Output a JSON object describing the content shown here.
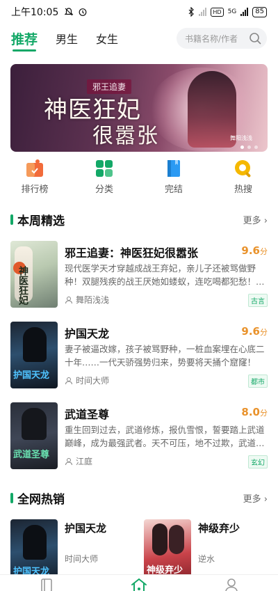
{
  "status_bar": {
    "time": "上午10:05",
    "network": "5G",
    "battery": "85"
  },
  "top_tabs": [
    {
      "label": "推荐",
      "active": true
    },
    {
      "label": "男生",
      "active": false
    },
    {
      "label": "女生",
      "active": false
    }
  ],
  "search": {
    "placeholder": "书籍名称/作者"
  },
  "banner": {
    "subtitle": "邪王追妻",
    "title_line1": "神医狂妃",
    "title_line2": "很嚣张",
    "author_mark": "舞阳浅浅"
  },
  "quick_entries": [
    {
      "label": "排行榜",
      "icon": "ranking-icon",
      "color": "#f26b3a"
    },
    {
      "label": "分类",
      "icon": "category-icon",
      "color": "#13a867"
    },
    {
      "label": "完结",
      "icon": "finished-book-icon",
      "color": "#2b9af3"
    },
    {
      "label": "热搜",
      "icon": "hot-search-icon",
      "color": "#f5b800"
    }
  ],
  "weekly": {
    "title": "本周精选",
    "more": "更多",
    "books": [
      {
        "name": "邪王追妻：神医狂妃很嚣张",
        "score": "9.6",
        "unit": "分",
        "desc": "现代医学天才穿越成战王弃妃，亲儿子还被骂做野种！双腿残疾的战王厌她如蝼蚁，连吃喝都犯愁！…",
        "author": "舞陌浅浅",
        "tag": "古言",
        "cover_text": "神医狂妃"
      },
      {
        "name": "护国天龙",
        "score": "9.6",
        "unit": "分",
        "desc": "妻子被逼改嫁，孩子被骂野种，一桩血案埋在心底二十年……一代天骄强势归来，势要将天捅个窟窿！",
        "author": "时间大师",
        "tag": "都市",
        "cover_text": "护国天龙"
      },
      {
        "name": "武道圣尊",
        "score": "8.0",
        "unit": "分",
        "desc": "重生回到过去，武道修炼，报仇雪恨，誓要踏上武道巅峰，成为最强武者。天不可压，地不过欺，武道…",
        "author": "江庭",
        "tag": "玄幻",
        "cover_text": "武道圣尊"
      }
    ]
  },
  "hot": {
    "title": "全网热销",
    "more": "更多",
    "books": [
      {
        "name": "护国天龙",
        "author": "时间大师",
        "cover_text": "护国天龙"
      },
      {
        "name": "神级弃少",
        "author": "逆水",
        "cover_text": "神级弃少"
      }
    ]
  },
  "bottom_nav": [
    {
      "icon": "bookshelf-icon",
      "active": false
    },
    {
      "icon": "home-icon",
      "active": true
    },
    {
      "icon": "profile-icon",
      "active": false
    }
  ]
}
